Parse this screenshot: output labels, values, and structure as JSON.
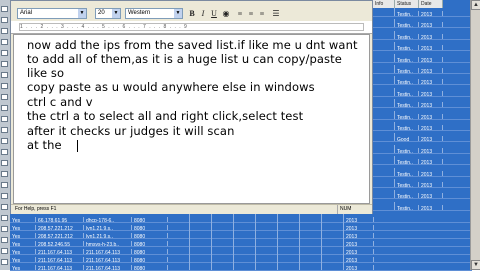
{
  "wordpad": {
    "font_name": "Arial",
    "font_size": "20",
    "script": "Western",
    "ruler_marks": "1 . . . 2 . . . 3 . . . 4 . . . 5 . . . 6 . . . 7 . . . 8 . . . 9",
    "status_help": "For Help, press F1",
    "status_mode": "NUM",
    "lines": [
      "now add the ips from the saved list.if like me u dnt want",
      "to add all of them,as it is a huge list u can copy/paste",
      "like so",
      "copy paste as u would anywhere else in windows",
      "ctrl c and v",
      "the ctrl a to select all and right click,select test",
      "after it checks ur judges it will scan",
      "at the"
    ]
  },
  "right_table": {
    "headers": [
      "Info",
      "Status",
      "Date"
    ],
    "rows": [
      [
        "",
        "Testin..",
        "2013"
      ],
      [
        "",
        "Testin..",
        "2013"
      ],
      [
        "",
        "Testin..",
        "2013"
      ],
      [
        "",
        "Testin..",
        "2013"
      ],
      [
        "",
        "Testin..",
        "2013"
      ],
      [
        "",
        "Testin..",
        "2013"
      ],
      [
        "",
        "Testin..",
        "2013"
      ],
      [
        "",
        "Testin..",
        "2013"
      ],
      [
        "",
        "Testin..",
        "2013"
      ],
      [
        "",
        "Testin..",
        "2013"
      ],
      [
        "",
        "Testin..",
        "2013"
      ],
      [
        "",
        "Good",
        "2013"
      ],
      [
        "",
        "Testin..",
        "2013"
      ],
      [
        "",
        "Testin..",
        "2013"
      ],
      [
        "",
        "Testin..",
        "2013"
      ],
      [
        "",
        "Testin..",
        "2013"
      ],
      [
        "",
        "Testin..",
        "2013"
      ],
      [
        "",
        "Testin..",
        "2013"
      ]
    ]
  },
  "bottom_table": {
    "rows": [
      [
        "Yes",
        "66.178.61.95",
        "dhcp-178-6..",
        "8080",
        "",
        "",
        "",
        "",
        "",
        "",
        "",
        "",
        "2013"
      ],
      [
        "Yes",
        "208.57.221.212",
        "lvn1.21.9.s..",
        "8080",
        "",
        "",
        "",
        "",
        "",
        "",
        "",
        "",
        "2013"
      ],
      [
        "Yes",
        "208.57.221.212",
        "lvn1.21.9.s..",
        "8080",
        "",
        "",
        "",
        "",
        "",
        "",
        "",
        "",
        "2013"
      ],
      [
        "Yes",
        "208.52.246.55",
        "hmsvs-h-23.b..",
        "8080",
        "",
        "",
        "",
        "",
        "",
        "",
        "",
        "",
        "2013"
      ],
      [
        "Yes",
        "211.167.64.113",
        "211.167.64.113",
        "8080",
        "",
        "",
        "",
        "",
        "",
        "",
        "",
        "",
        "2013"
      ],
      [
        "Yes",
        "211.167.64.113",
        "211.167.64.113",
        "8080",
        "",
        "",
        "",
        "",
        "",
        "",
        "",
        "",
        "2013"
      ],
      [
        "Yes",
        "211.167.64.113",
        "211.167.64.113",
        "8080",
        "",
        "",
        "",
        "",
        "",
        "",
        "",
        "",
        "2013"
      ]
    ]
  },
  "colors": {
    "table_blue": "#2f6fc6",
    "window_face": "#ece9d8"
  }
}
